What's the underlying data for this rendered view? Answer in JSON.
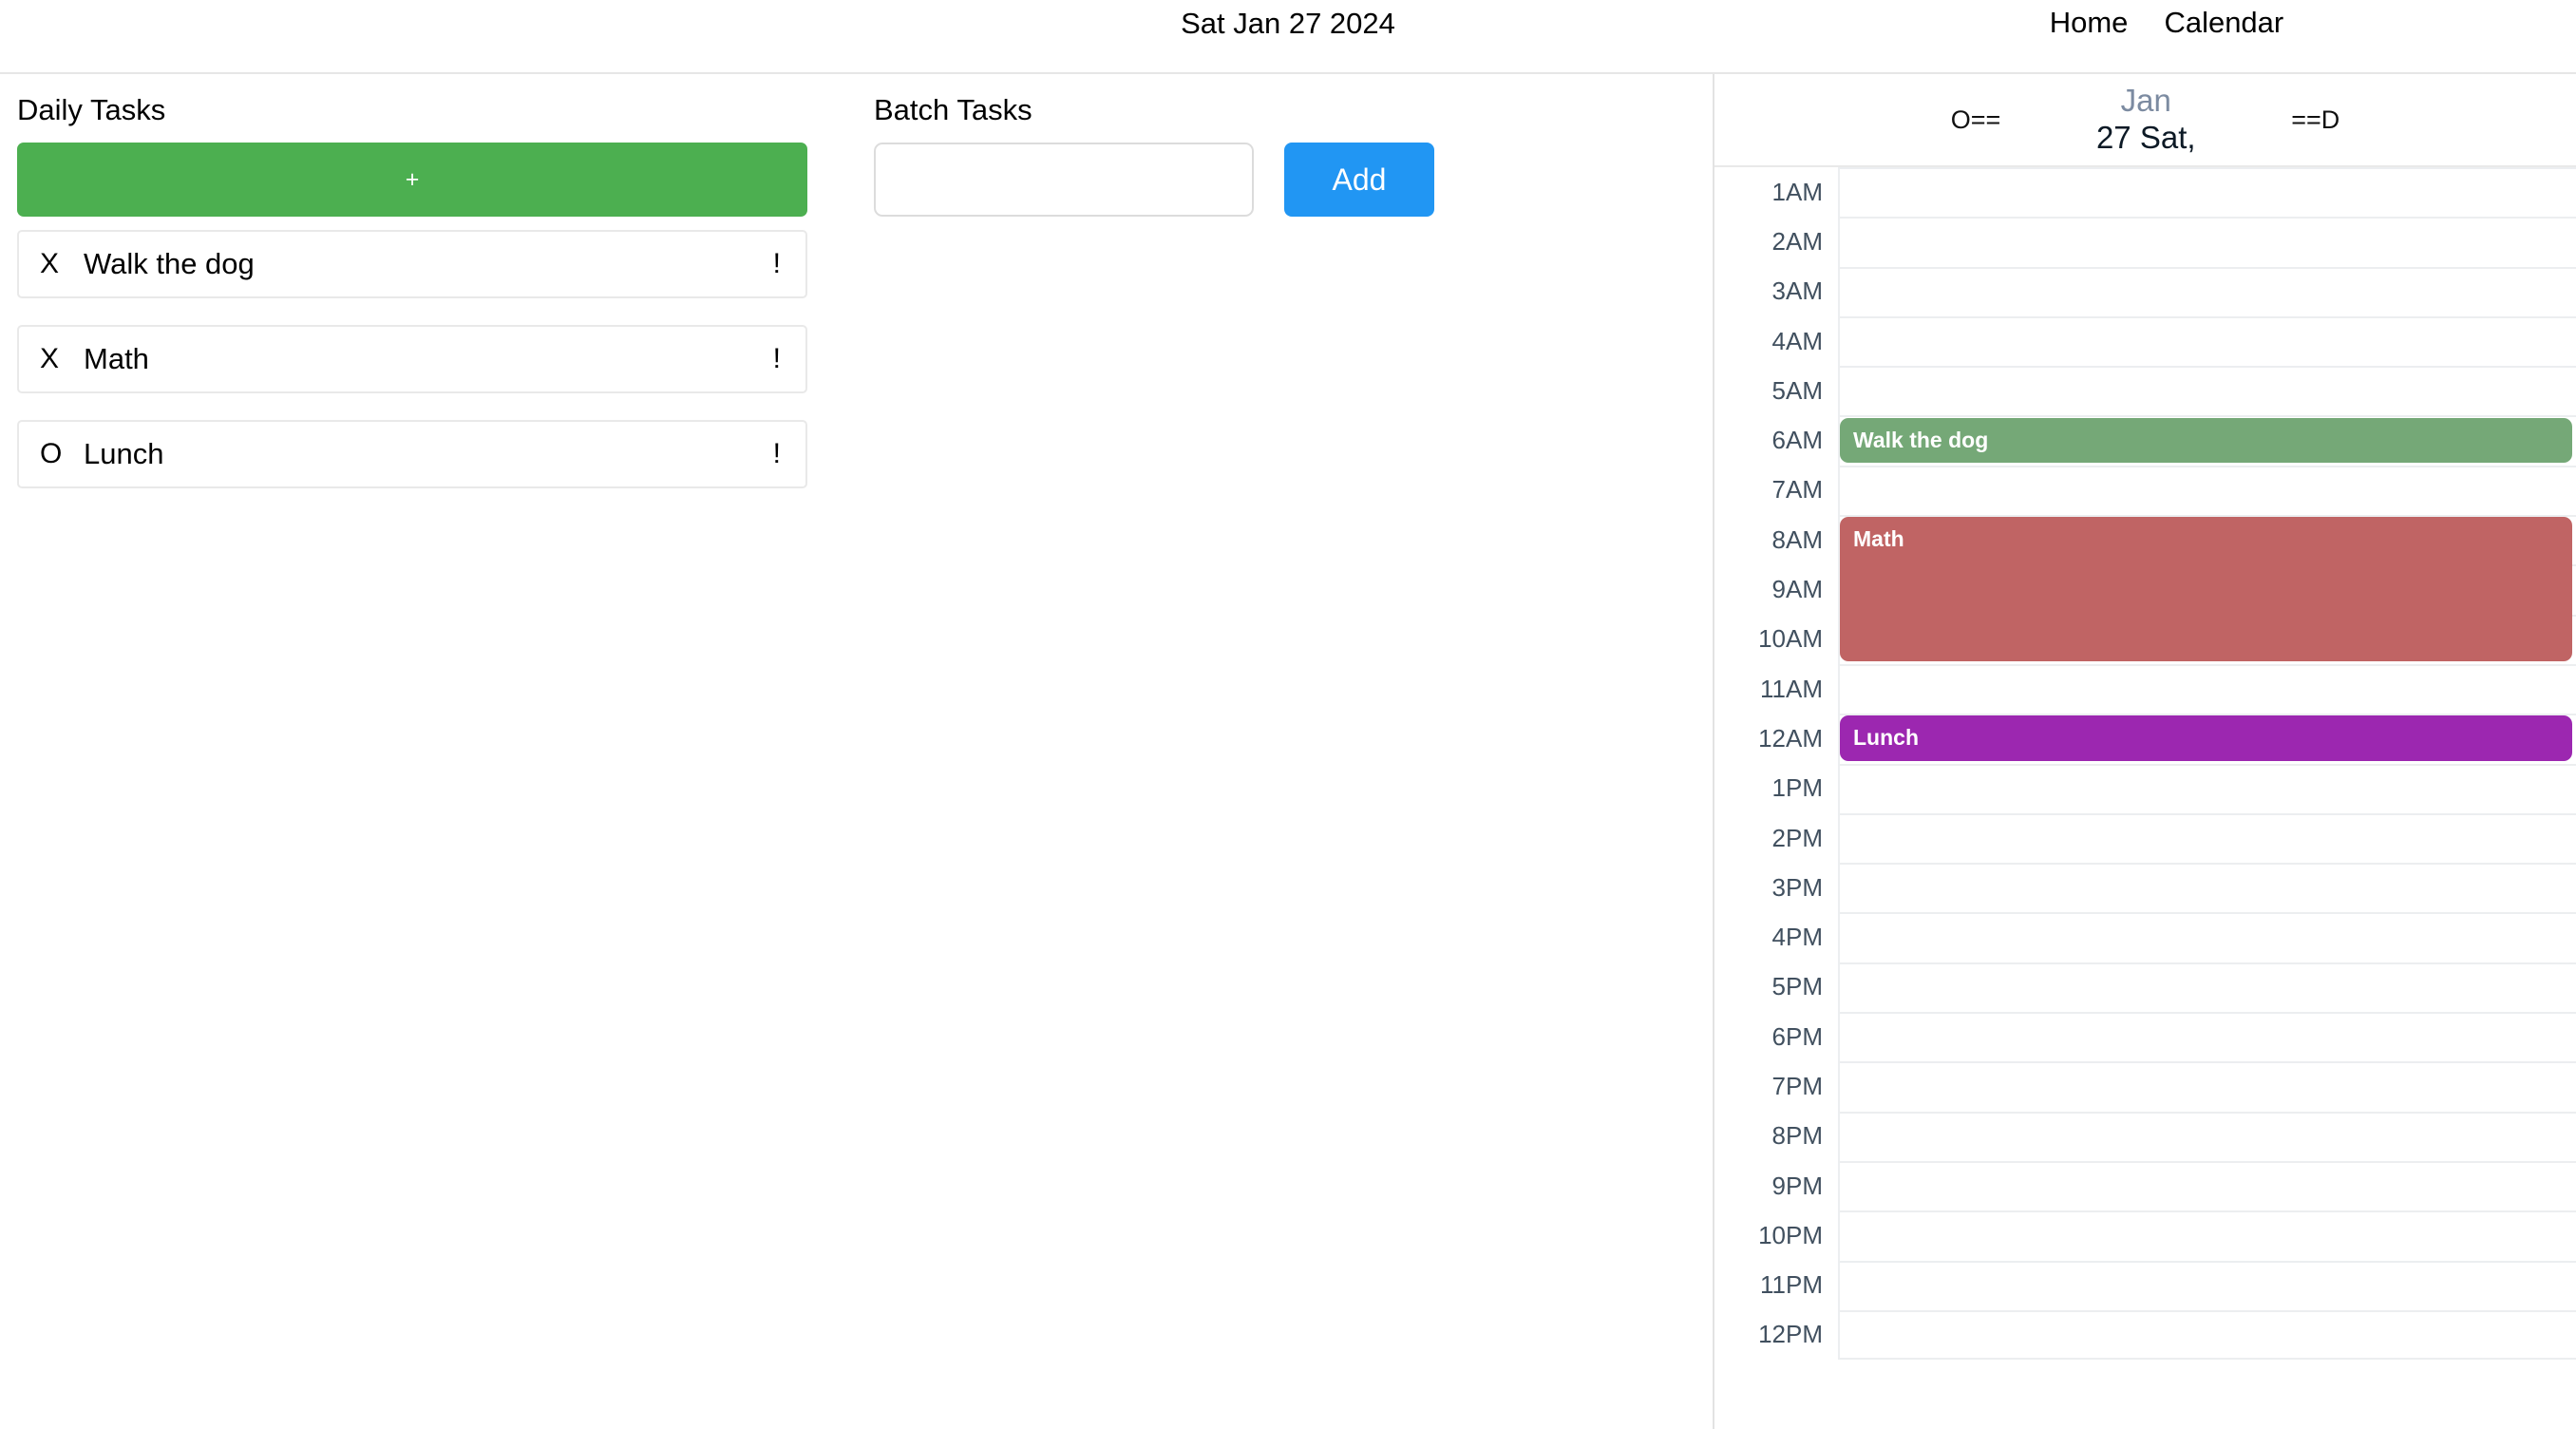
{
  "header": {
    "date_title": "Sat Jan 27 2024",
    "nav": [
      {
        "label": "Home",
        "name": "nav-link-home"
      },
      {
        "label": "Calendar",
        "name": "nav-link-calendar"
      }
    ]
  },
  "daily": {
    "title": "Daily Tasks",
    "add_button_label": "+",
    "tasks": [
      {
        "status": "X",
        "label": "Walk the dog",
        "priority": "!"
      },
      {
        "status": "X",
        "label": "Math",
        "priority": "!"
      },
      {
        "status": "O",
        "label": "Lunch",
        "priority": "!"
      }
    ]
  },
  "batch": {
    "title": "Batch Tasks",
    "input_value": "",
    "input_placeholder": "",
    "add_button_label": "Add"
  },
  "calendar": {
    "prev_label": "O==",
    "next_label": "==D",
    "month": "Jan",
    "day": "27 Sat,",
    "hours": [
      "1AM",
      "2AM",
      "3AM",
      "4AM",
      "5AM",
      "6AM",
      "7AM",
      "8AM",
      "9AM",
      "10AM",
      "11AM",
      "12AM",
      "1PM",
      "2PM",
      "3PM",
      "4PM",
      "5PM",
      "6PM",
      "7PM",
      "8PM",
      "9PM",
      "10PM",
      "11PM",
      "12PM"
    ],
    "events": [
      {
        "title": "Walk the dog",
        "color": "#75a877",
        "start_hour_index": 5,
        "span_hours": 1
      },
      {
        "title": "Math",
        "color": "#c06464",
        "start_hour_index": 7,
        "span_hours": 3
      },
      {
        "title": "Lunch",
        "color": "#9c27b0",
        "start_hour_index": 11,
        "span_hours": 1
      }
    ]
  },
  "colors": {
    "add_task_green": "#4caf50",
    "add_button_blue": "#2196f3",
    "event_green": "#75a877",
    "event_red": "#c06464",
    "event_purple": "#9c27b0",
    "hour_text": "#41505f",
    "month_text": "#7c8ba1"
  }
}
